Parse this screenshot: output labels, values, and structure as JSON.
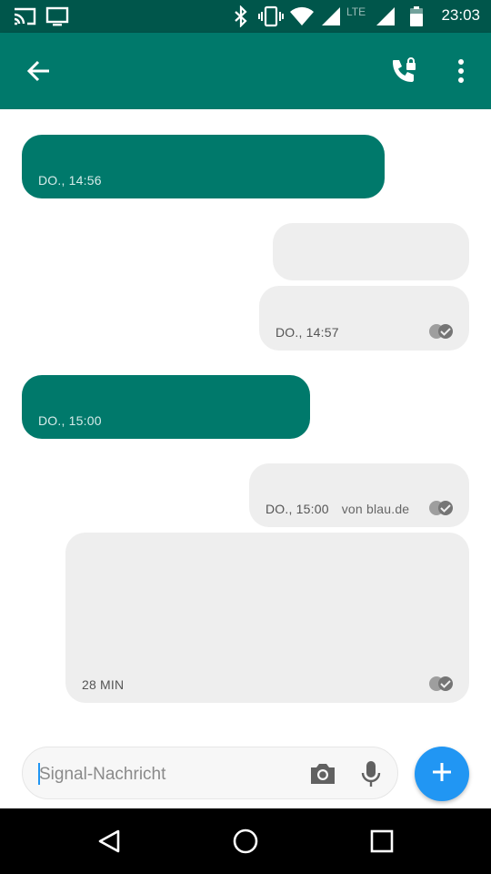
{
  "status_bar": {
    "time": "23:03",
    "network_label": "LTE",
    "icons": [
      "cast-icon",
      "screen-icon",
      "bluetooth-icon",
      "vibrate-icon",
      "wifi-icon",
      "signal-icon",
      "signal-icon",
      "battery-icon"
    ]
  },
  "app_bar": {
    "back_icon": "back-arrow-icon",
    "call_icon": "secure-call-icon",
    "menu_icon": "more-vert-icon"
  },
  "messages": [
    {
      "direction": "incoming",
      "meta": "DO., 14:56"
    },
    {
      "direction": "outgoing",
      "meta": ""
    },
    {
      "direction": "outgoing",
      "meta": "DO., 14:57",
      "status": "delivered"
    },
    {
      "direction": "incoming",
      "meta": "DO., 15:00"
    },
    {
      "direction": "outgoing",
      "meta": "DO., 15:00",
      "via": "von blau.de",
      "status": "delivered"
    },
    {
      "direction": "outgoing",
      "meta": "28 MIN",
      "status": "delivered"
    }
  ],
  "composer": {
    "placeholder": "Signal-Nachricht",
    "camera_icon": "camera-icon",
    "mic_icon": "mic-icon",
    "send_icon": "add-icon"
  },
  "nav_bar": {
    "icons": [
      "back-triangle-icon",
      "home-circle-icon",
      "recents-square-icon"
    ]
  },
  "colors": {
    "status_bar": "#00564b",
    "app_bar": "#00796b",
    "incoming_bubble": "#00796b",
    "outgoing_bubble": "#eeeeee",
    "fab": "#2196f3"
  }
}
